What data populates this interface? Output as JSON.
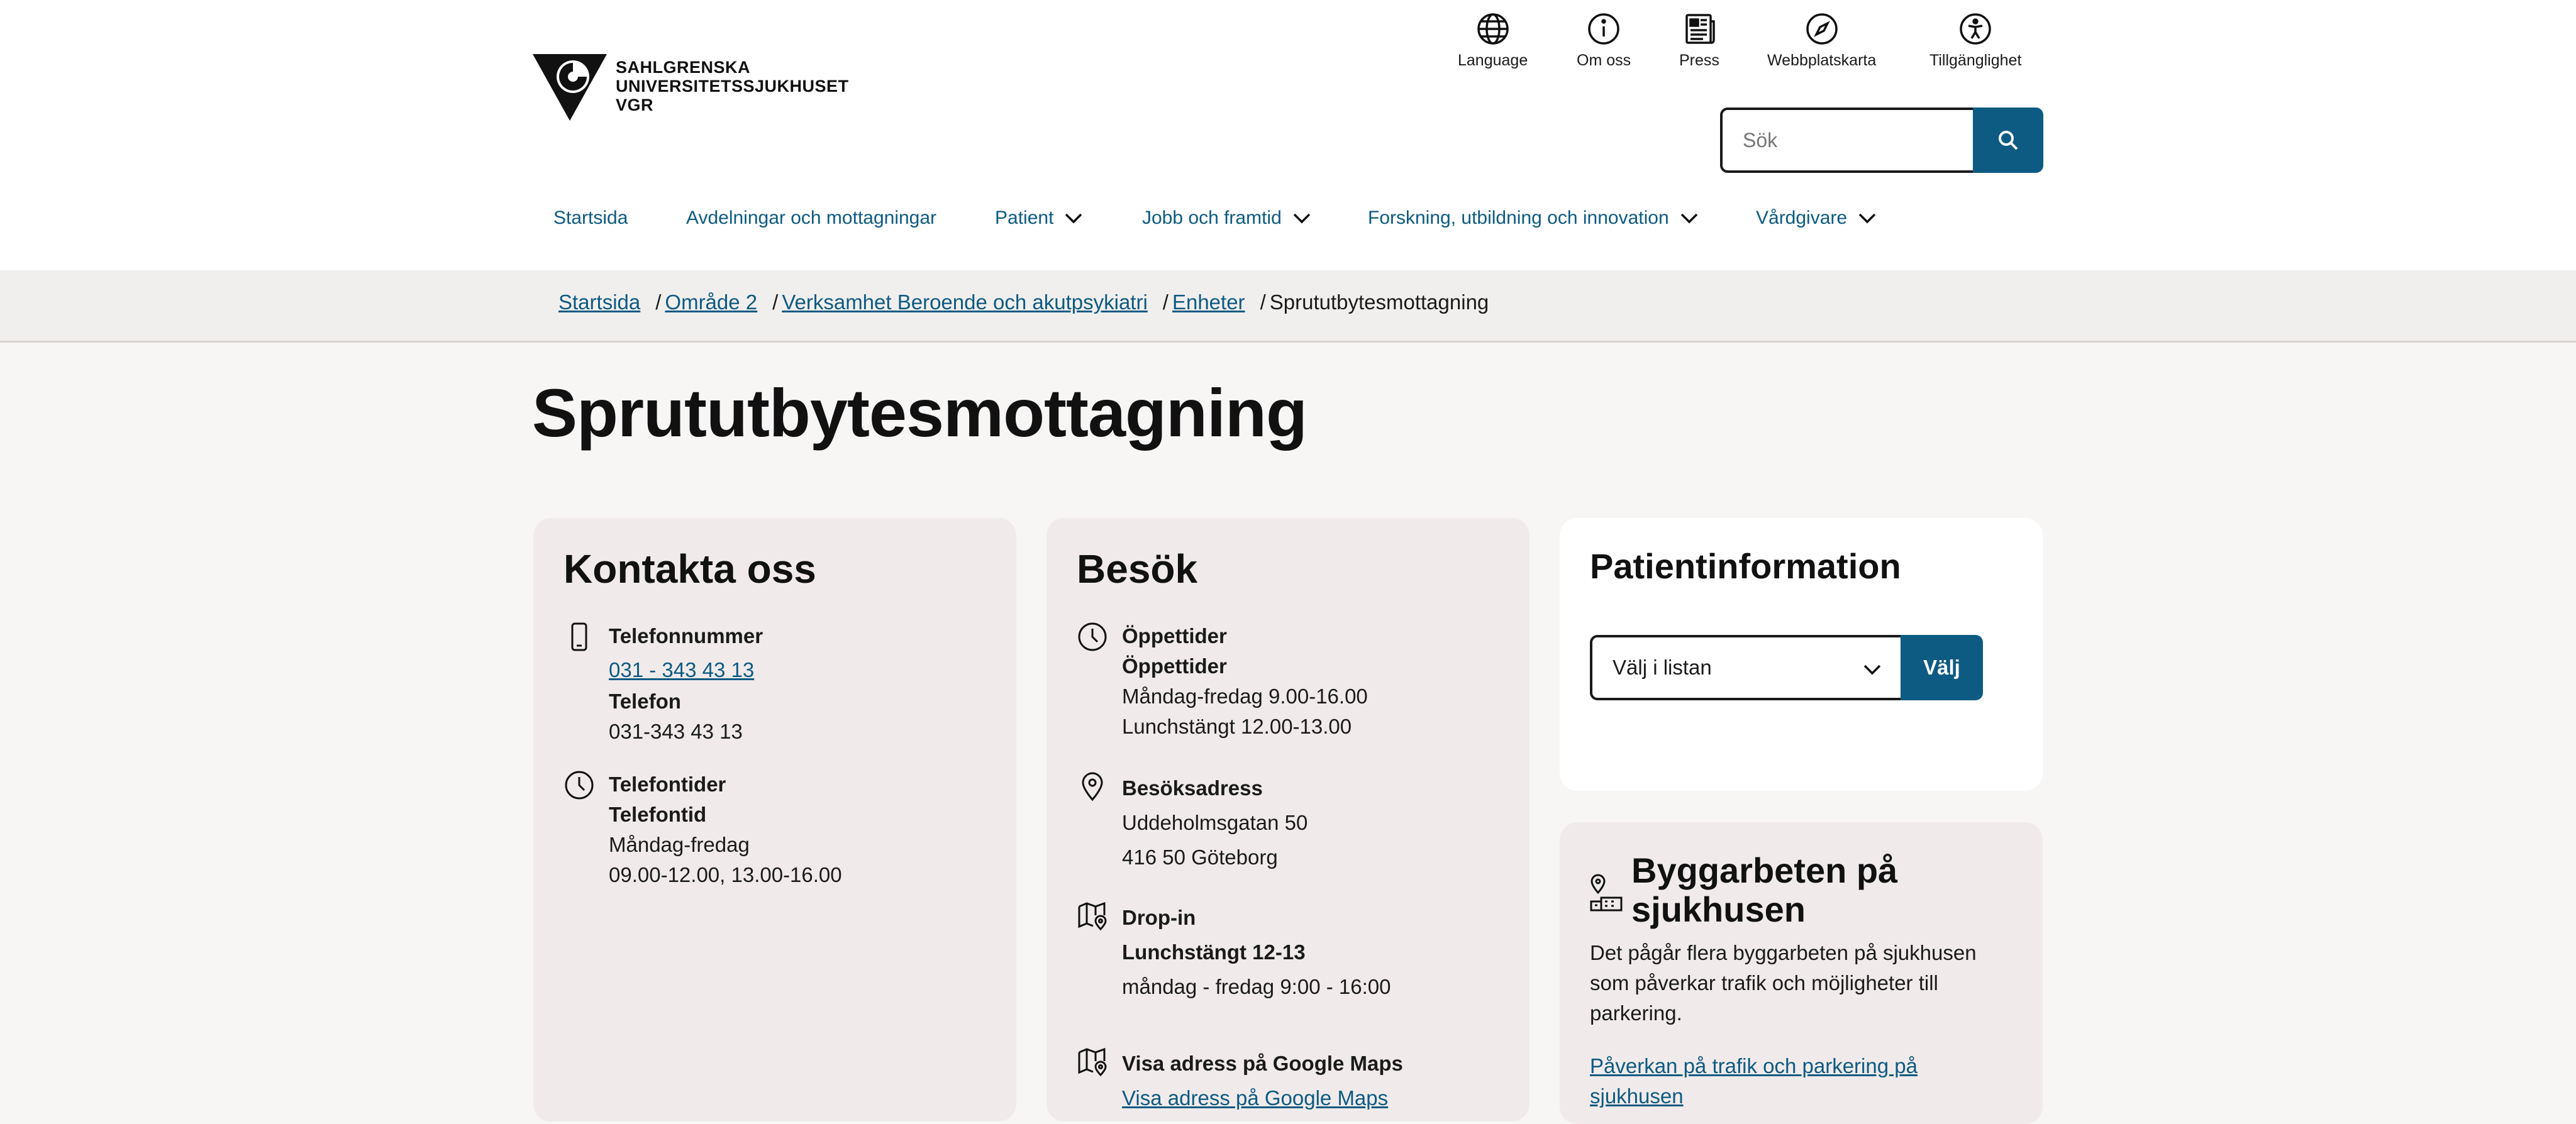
{
  "brand": {
    "line1": "SAHLGRENSKA",
    "line2": "UNIVERSITETSSJUKHUSET",
    "line3": "VGR"
  },
  "utility_nav": [
    {
      "label": "Language",
      "icon": "globe-icon"
    },
    {
      "label": "Om oss",
      "icon": "info-icon"
    },
    {
      "label": "Press",
      "icon": "newspaper-icon"
    },
    {
      "label": "Webbplatskarta",
      "icon": "compass-icon"
    },
    {
      "label": "Tillgänglighet",
      "icon": "accessibility-icon"
    }
  ],
  "search": {
    "placeholder": "Sök",
    "icon": "search-icon"
  },
  "main_nav": [
    {
      "label": "Startsida",
      "has_dropdown": false
    },
    {
      "label": "Avdelningar och mottagningar",
      "has_dropdown": false
    },
    {
      "label": "Patient",
      "has_dropdown": true
    },
    {
      "label": "Jobb och framtid",
      "has_dropdown": true
    },
    {
      "label": "Forskning, utbildning och innovation",
      "has_dropdown": true
    },
    {
      "label": "Vårdgivare",
      "has_dropdown": true
    }
  ],
  "breadcrumb": [
    {
      "label": "Startsida",
      "link": true
    },
    {
      "label": "Område 2",
      "link": true
    },
    {
      "label": "Verksamhet Beroende och akutpsykiatri",
      "link": true
    },
    {
      "label": "Enheter",
      "link": true
    },
    {
      "label": "Sprututbytesmottagning",
      "link": false
    }
  ],
  "page_title": "Sprututbytesmottagning",
  "contact": {
    "heading": "Kontakta oss",
    "phone_label": "Telefonnummer",
    "phone_link": "031 - 343 43 13",
    "phone_sub_label": "Telefon",
    "phone_value": "031-343 43 13",
    "hours_label": "Telefontider",
    "hours_sub_label": "Telefontid",
    "hours_line1": "Måndag-fredag",
    "hours_line2": "09.00-12.00, 13.00-16.00"
  },
  "visit": {
    "heading": "Besök",
    "open_label": "Öppettider",
    "open_sub_label": "Öppettider",
    "open_line1": "Måndag-fredag 9.00-16.00",
    "open_line2": "Lunchstängt 12.00-13.00",
    "address_label": "Besöksadress",
    "address_line1": "Uddeholmsgatan 50",
    "address_line2": "416 50 Göteborg",
    "dropin_label": "Drop-in",
    "dropin_sub_label": "Lunchstängt 12-13",
    "dropin_line": "måndag - fredag 9:00 - 16:00",
    "maps_label": "Visa adress på Google Maps",
    "maps_link": "Visa adress på Google Maps"
  },
  "patient_info": {
    "heading": "Patientinformation",
    "select_value": "Välj i listan",
    "button_label": "Välj"
  },
  "construction": {
    "heading": "Byggarbeten på sjukhusen",
    "body": "Det pågår flera byggarbeten på sjukhusen som påverkar trafik och möjligheter till parkering.",
    "link": "Påverkan på trafik och parkering på sjukhusen"
  },
  "colors": {
    "accent": "#0d5a82",
    "card_grey": "#f0ebea",
    "page_bg": "#f7f6f5"
  }
}
